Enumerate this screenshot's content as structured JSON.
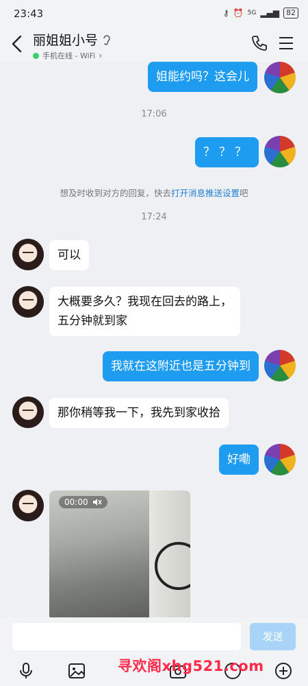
{
  "status_bar": {
    "time": "23:43",
    "signal": "5G",
    "battery": "82"
  },
  "header": {
    "title": "丽姐姐小号",
    "subtitle": "手机在线 - WiFi"
  },
  "messages": [
    {
      "side": "out",
      "text": "姐能约吗？这会儿"
    },
    {
      "type": "time",
      "text": "17:06"
    },
    {
      "side": "out",
      "text": "？？？"
    },
    {
      "type": "notice",
      "text_before": "想及时收到对方的回复，快去",
      "link": "打开消息推送设置",
      "text_after": "吧"
    },
    {
      "type": "time",
      "text": "17:24"
    },
    {
      "side": "in",
      "text": "可以"
    },
    {
      "side": "in",
      "text_line1": "大概要多久？我现在回去的路上，",
      "text_line2": "五分钟就到家"
    },
    {
      "side": "out",
      "text": "我就在这附近也是五分钟到"
    },
    {
      "side": "in",
      "text": "那你稍等我一下，我先到家收拾"
    },
    {
      "side": "out",
      "text": "好嘞"
    },
    {
      "side": "in",
      "type": "video",
      "duration": "00:00"
    }
  ],
  "input": {
    "placeholder": "",
    "send_label": "发送"
  },
  "toolbar": {
    "icons": [
      "microphone-icon",
      "image-icon",
      "camera-icon",
      "emoji-icon",
      "plus-icon"
    ]
  },
  "watermark": "寻欢阁xhg521.com"
}
